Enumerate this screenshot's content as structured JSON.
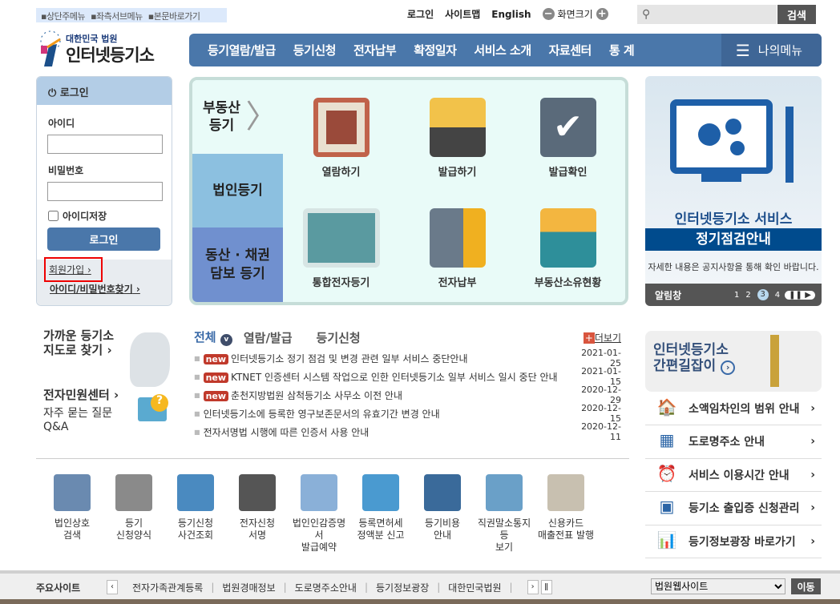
{
  "skip_links": [
    "상단주메뉴",
    "좌측서브메뉴",
    "본문바로가기"
  ],
  "top_links": {
    "login": "로그인",
    "sitemap": "사이트맵",
    "english": "English",
    "screen_size": "화면크기"
  },
  "search": {
    "placeholder": "",
    "button": "검색"
  },
  "logo": {
    "org": "대한민국 법원",
    "name": "인터넷등기소"
  },
  "nav": {
    "items": [
      "등기열람/발급",
      "등기신청",
      "전자납부",
      "확정일자",
      "서비스 소개",
      "자료센터",
      "통 계"
    ],
    "my_menu": "나의메뉴"
  },
  "login_box": {
    "title": "로그인",
    "id_label": "아이디",
    "pw_label": "비밀번호",
    "save_id": "아이디저장",
    "login_button": "로그인",
    "join": "회원가입",
    "find": "아이디/비밀번호찾기"
  },
  "center": {
    "tabs": [
      "부동산 등기",
      "법인등기",
      "동산 · 채권 담보 등기"
    ],
    "services": [
      "열람하기",
      "발급하기",
      "발급확인",
      "통합전자등기",
      "전자납부",
      "부동산소유현황"
    ]
  },
  "banner": {
    "line1": "인터넷등기소 서비스",
    "line2": "정기점검안내",
    "line3": "자세한 내용은 공지사항을 통해 확인 바랍니다.",
    "bar_label": "알림창",
    "pages": [
      "1",
      "2",
      "3",
      "4"
    ],
    "active_page": 3
  },
  "left_links": {
    "map": "가까운 등기소 지도로 찾기",
    "center": "전자민원센터",
    "faq": "자주 묻는 질문 Q&A"
  },
  "news": {
    "tabs": [
      "전체",
      "열람/발급",
      "등기신청"
    ],
    "more": "더보기",
    "badge": "new",
    "items": [
      {
        "title": "인터넷등기소 정기 점검 및 변경 관련 일부 서비스 중단안내",
        "date": "2021-01-25",
        "new": true
      },
      {
        "title": "KTNET 인증센터 시스템 작업으로 인한 인터넷등기소 일부 서비스 일시 중단 안내",
        "date": "2021-01-15",
        "new": true
      },
      {
        "title": "춘천지방법원 삼척등기소 사무소 이전 안내",
        "date": "2020-12-29",
        "new": true
      },
      {
        "title": "인터넷등기소에 등록한 영구보존문서의 유효기간 변경 안내",
        "date": "2020-12-15",
        "new": false
      },
      {
        "title": "전자서명법 시행에 따른 인증서 사용 안내",
        "date": "2020-12-11",
        "new": false
      }
    ]
  },
  "quick": [
    [
      "법인상호",
      "검색"
    ],
    [
      "등기",
      "신청양식"
    ],
    [
      "등기신청",
      "사건조회"
    ],
    [
      "전자신청",
      "서명"
    ],
    [
      "법인인감증명서",
      "발급예약"
    ],
    [
      "등록면허세",
      "정액분 신고"
    ],
    [
      "등기비용",
      "안내"
    ],
    [
      "직권말소통지등",
      "보기"
    ],
    [
      "신용카드",
      "매출전표 발행"
    ]
  ],
  "guide": {
    "line1": "인터넷등기소",
    "line2": "간편길잡이"
  },
  "right_links": [
    "소액임차인의 범위 안내",
    "도로명주소 안내",
    "서비스 이용시간 안내",
    "등기소 출입증 신청관리",
    "등기정보광장 바로가기"
  ],
  "footer": {
    "label": "주요사이트",
    "sites": [
      "전자가족관계등록",
      "법원경매정보",
      "도로명주소안내",
      "등기정보광장",
      "대한민국법원"
    ],
    "select": "법원웹사이트",
    "go": "이동"
  },
  "colors": {
    "nav": "#4a77aa",
    "new_badge": "#c0392b",
    "banner_band": "#004b8d"
  }
}
